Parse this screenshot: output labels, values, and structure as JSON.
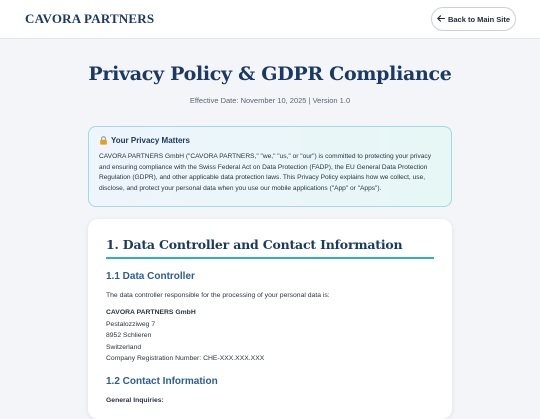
{
  "header": {
    "brand": "CAVORA PARTNERS",
    "back_label": "Back to Main Site",
    "back_icon": "arrow-left-icon"
  },
  "page": {
    "title": "Privacy Policy & GDPR Compliance",
    "effective": "Effective Date: November 10, 2025 | Version 1.0"
  },
  "notice": {
    "icon": "lock-icon",
    "heading": "Your Privacy Matters",
    "body": "CAVORA PARTNERS GmbH (\"CAVORA PARTNERS,\" \"we,\" \"us,\" or \"our\") is committed to protecting your privacy and ensuring compliance with the Swiss Federal Act on Data Protection (FADP), the EU General Data Protection Regulation (GDPR), and other applicable data protection laws. This Privacy Policy explains how we collect, use, disclose, and protect your personal data when you use our mobile applications (\"App\" or \"Apps\")."
  },
  "section1": {
    "title": "1. Data Controller and Contact Information",
    "sub1": "1.1 Data Controller",
    "intro": "The data controller responsible for the processing of your personal data is:",
    "company": "CAVORA PARTNERS GmbH",
    "street": "Pestalozziweg 7",
    "city": "8952 Schlieren",
    "country": "Switzerland",
    "registration": "Company Registration Number: CHE-XXX.XXX.XXX",
    "sub2": "1.2 Contact Information",
    "general": "General Inquiries:"
  },
  "colors": {
    "brand": "#1b3a63",
    "accent": "#2fb3b0",
    "subheading": "#2b5d96"
  }
}
